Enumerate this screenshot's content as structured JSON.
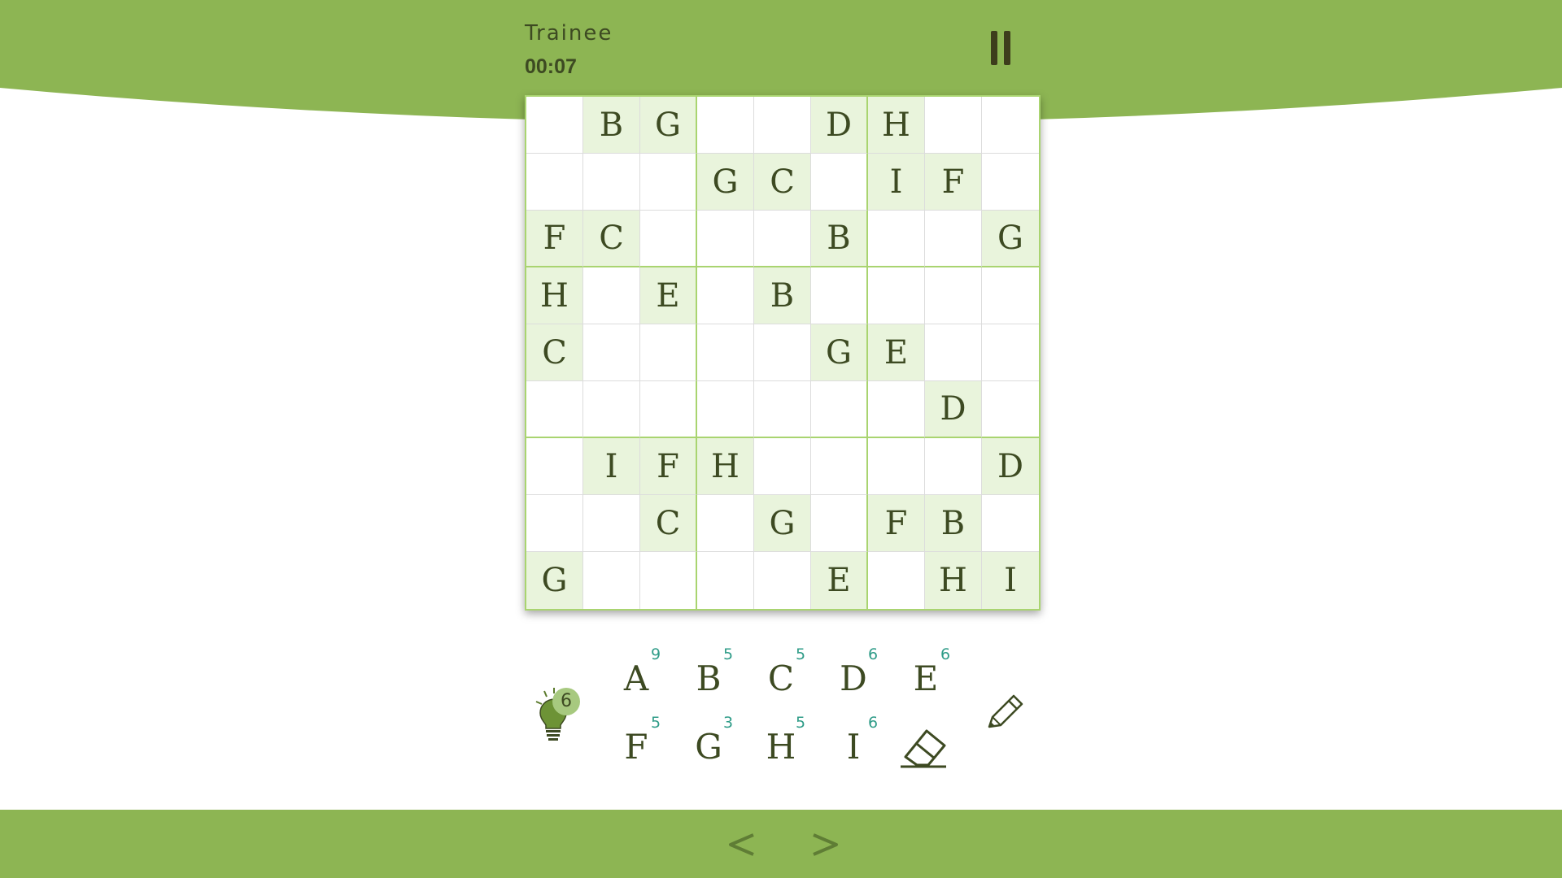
{
  "header": {
    "difficulty": "Trainee",
    "timer": "00:07"
  },
  "board": {
    "rows": [
      [
        "",
        "B",
        "G",
        "",
        "",
        "D",
        "H",
        "",
        ""
      ],
      [
        "",
        "",
        "",
        "G",
        "C",
        "",
        "I",
        "F",
        ""
      ],
      [
        "F",
        "C",
        "",
        "",
        "",
        "B",
        "",
        "",
        "G"
      ],
      [
        "H",
        "",
        "E",
        "",
        "B",
        "",
        "",
        "",
        ""
      ],
      [
        "C",
        "",
        "",
        "",
        "",
        "G",
        "E",
        "",
        ""
      ],
      [
        "",
        "",
        "",
        "",
        "",
        "",
        "",
        "D",
        ""
      ],
      [
        "",
        "I",
        "F",
        "H",
        "",
        "",
        "",
        "",
        "D"
      ],
      [
        "",
        "",
        "C",
        "",
        "G",
        "",
        "F",
        "B",
        ""
      ],
      [
        "G",
        "",
        "",
        "",
        "",
        "E",
        "",
        "H",
        "I"
      ]
    ]
  },
  "hint": {
    "count": "6",
    "icon": "lightbulb-icon"
  },
  "keypad": [
    {
      "letter": "A",
      "count": "9"
    },
    {
      "letter": "B",
      "count": "5"
    },
    {
      "letter": "C",
      "count": "5"
    },
    {
      "letter": "D",
      "count": "6"
    },
    {
      "letter": "E",
      "count": "6"
    },
    {
      "letter": "F",
      "count": "5"
    },
    {
      "letter": "G",
      "count": "3"
    },
    {
      "letter": "H",
      "count": "5"
    },
    {
      "letter": "I",
      "count": "6"
    }
  ],
  "tools": {
    "eraser_icon": "eraser-icon",
    "pencil_icon": "pencil-icon"
  },
  "navigation": {
    "prev_icon": "chevron-left-icon",
    "next_icon": "chevron-right-icon"
  },
  "colors": {
    "accent_green": "#8db553",
    "given_cell": "#e9f4dc",
    "grid_border": "#a9d470",
    "text_dark": "#3d4a22",
    "count_teal": "#2f9c88"
  }
}
